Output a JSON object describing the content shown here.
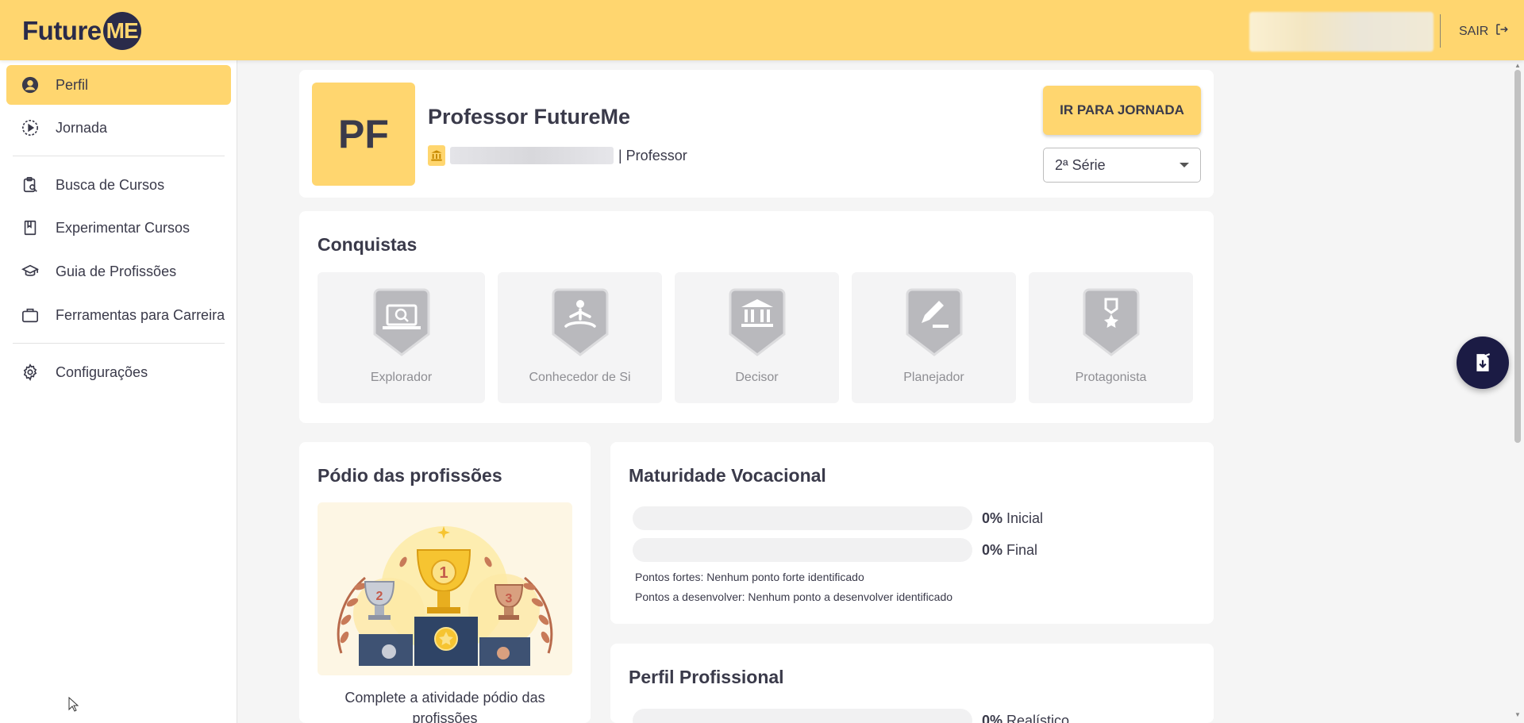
{
  "header": {
    "logo_text": "Future",
    "logo_badge": "ME",
    "logout_label": "SAIR"
  },
  "sidebar": {
    "items": [
      {
        "label": "Perfil",
        "icon": "user-circle-icon",
        "active": true
      },
      {
        "label": "Jornada",
        "icon": "play-circle-icon"
      },
      {
        "label": "Busca de Cursos",
        "icon": "clipboard-search-icon"
      },
      {
        "label": "Experimentar Cursos",
        "icon": "bookmark-book-icon"
      },
      {
        "label": "Guia de Profissões",
        "icon": "graduation-cap-icon"
      },
      {
        "label": "Ferramentas para Carreira",
        "icon": "briefcase-icon"
      },
      {
        "label": "Configurações",
        "icon": "gear-icon"
      }
    ]
  },
  "profile": {
    "initials": "PF",
    "name": "Professor FutureMe",
    "role": "| Professor",
    "journey_button": "IR PARA JORNADA",
    "grade_selected": "2ª Série"
  },
  "achievements": {
    "title": "Conquistas",
    "badges": [
      {
        "label": "Explorador",
        "icon": "laptop-search-icon"
      },
      {
        "label": "Conhecedor de Si",
        "icon": "meditation-icon"
      },
      {
        "label": "Decisor",
        "icon": "institution-icon"
      },
      {
        "label": "Planejador",
        "icon": "pencil-edit-icon"
      },
      {
        "label": "Protagonista",
        "icon": "medal-star-icon"
      }
    ]
  },
  "podium": {
    "title": "Pódio das profissões",
    "text": "Complete a atividade pódio das profissões"
  },
  "maturity": {
    "title": "Maturidade Vocacional",
    "bars": [
      {
        "pct": "0%",
        "label": "Inicial",
        "value": 0
      },
      {
        "pct": "0%",
        "label": "Final",
        "value": 0
      }
    ],
    "strengths": "Pontos fortes: Nenhum ponto forte identificado",
    "to_develop": "Pontos a desenvolver: Nenhum ponto a desenvolver identificado"
  },
  "professional": {
    "title": "Perfil Profissional",
    "bars": [
      {
        "pct": "0%",
        "label": "Realístico",
        "value": 0
      }
    ]
  },
  "colors": {
    "accent": "#ffd66f",
    "dark": "#2a2b4a",
    "fab": "#1b1b44"
  }
}
